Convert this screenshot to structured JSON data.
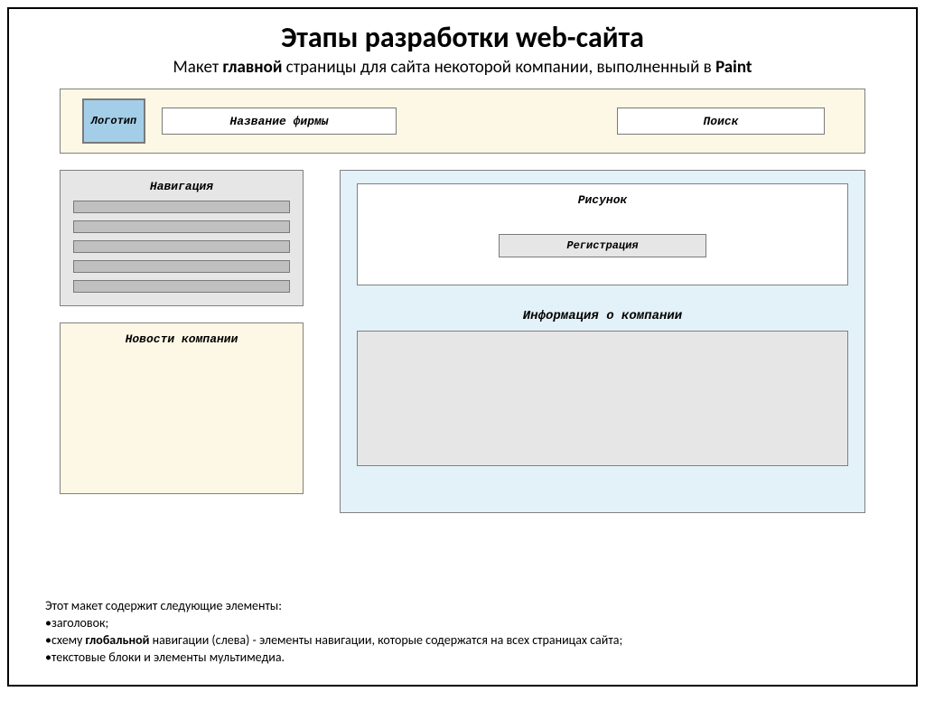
{
  "title": "Этапы разработки web-сайта",
  "subtitle_pre": "Макет ",
  "subtitle_bold1": "главной",
  "subtitle_post": " страницы для сайта некоторой компании, выполненный в ",
  "subtitle_bold2": "Paint",
  "mockup": {
    "logo": "Логотип",
    "firm_name": "Название фирмы",
    "search": "Поиск",
    "navigation": "Навигация",
    "news": "Новости компании",
    "picture": "Рисунок",
    "registration": "Регистрация",
    "company_info": "Информация о компании"
  },
  "notes": {
    "intro": "Этот макет содержит следующие элементы:",
    "b1": "•заголовок;",
    "b2_pre": "•схему ",
    "b2_bold": "глобальной",
    "b2_post": " навигации (слева) - элементы навигации, которые содержатся на всех страницах сайта;",
    "b3": "•текстовые блоки и элементы мультимедиа."
  }
}
